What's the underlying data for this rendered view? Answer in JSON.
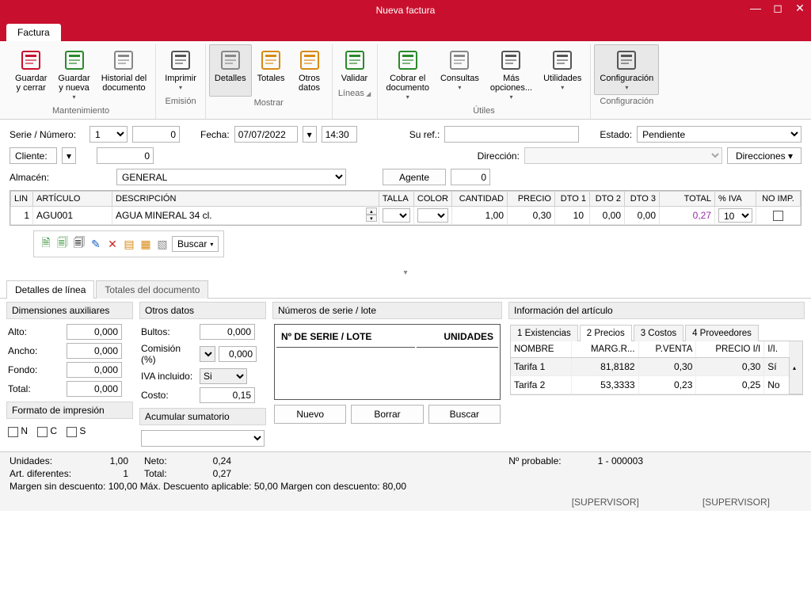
{
  "window": {
    "title": "Nueva factura"
  },
  "tab": {
    "label": "Factura"
  },
  "ribbon": {
    "groups": [
      {
        "label": "Mantenimiento",
        "buttons": [
          {
            "id": "save-close",
            "label": "Guardar\ny cerrar"
          },
          {
            "id": "save-new",
            "label": "Guardar\ny nueva",
            "drop": true
          },
          {
            "id": "doc-history",
            "label": "Historial del\ndocumento"
          }
        ]
      },
      {
        "label": "Emisión",
        "buttons": [
          {
            "id": "print",
            "label": "Imprimir",
            "drop": true
          }
        ]
      },
      {
        "label": "Mostrar",
        "buttons": [
          {
            "id": "details",
            "label": "Detalles",
            "sel": true
          },
          {
            "id": "totals",
            "label": "Totales"
          },
          {
            "id": "other-data",
            "label": "Otros\ndatos"
          }
        ]
      },
      {
        "label": "Líneas",
        "arrow": true,
        "buttons": [
          {
            "id": "validate",
            "label": "Validar"
          }
        ]
      },
      {
        "label": "Útiles",
        "buttons": [
          {
            "id": "charge",
            "label": "Cobrar el\ndocumento",
            "drop": true
          },
          {
            "id": "queries",
            "label": "Consultas",
            "drop": true
          },
          {
            "id": "more",
            "label": "Más\nopciones...",
            "drop": true
          },
          {
            "id": "utils",
            "label": "Utilidades",
            "drop": true
          }
        ]
      },
      {
        "label": "Configuración",
        "buttons": [
          {
            "id": "config",
            "label": "Configuración",
            "drop": true,
            "sel": true
          }
        ]
      }
    ]
  },
  "form": {
    "serie_label": "Serie / Número:",
    "serie": "1",
    "numero": "0",
    "fecha_label": "Fecha:",
    "fecha": "07/07/2022",
    "hora": "14:30",
    "suref_label": "Su ref.:",
    "suref": "",
    "estado_label": "Estado:",
    "estado": "Pendiente",
    "cliente_label": "Cliente:",
    "cliente": "0",
    "direccion_label": "Dirección:",
    "direccion": "",
    "direcciones_btn": "Direcciones",
    "almacen_label": "Almacén:",
    "almacen": "GENERAL",
    "agente_label": "Agente",
    "agente": "0"
  },
  "grid": {
    "headers": {
      "lin": "LIN",
      "art": "ARTÍCULO",
      "desc": "DESCRIPCIÓN",
      "talla": "TALLA",
      "color": "COLOR",
      "cant": "CANTIDAD",
      "precio": "PRECIO",
      "d1": "DTO 1",
      "d2": "DTO 2",
      "d3": "DTO 3",
      "total": "TOTAL",
      "iva": "% IVA",
      "noimp": "NO IMP."
    },
    "rows": [
      {
        "lin": "1",
        "art": "AGU001",
        "desc": "AGUA MINERAL 34 cl.",
        "talla": "",
        "color": "",
        "cant": "1,00",
        "precio": "0,30",
        "d1": "10",
        "d2": "0,00",
        "d3": "0,00",
        "total": "0,27",
        "iva": "10 %",
        "noimp": false
      }
    ]
  },
  "line_toolbar": {
    "search": "Buscar"
  },
  "bottom_tabs": {
    "a": "Detalles de línea",
    "b": "Totales del documento"
  },
  "dims": {
    "title": "Dimensiones auxiliares",
    "alto": "Alto:",
    "alto_v": "0,000",
    "ancho": "Ancho:",
    "ancho_v": "0,000",
    "fondo": "Fondo:",
    "fondo_v": "0,000",
    "total": "Total:",
    "total_v": "0,000",
    "fmt_title": "Formato de impresión",
    "n": "N",
    "c": "C",
    "s": "S"
  },
  "otros": {
    "title": "Otros datos",
    "bultos": "Bultos:",
    "bultos_v": "0,000",
    "comision": "Comisión (%)",
    "comision_v": "0,000",
    "iva": "IVA incluido:",
    "iva_v": "Si",
    "costo": "Costo:",
    "costo_v": "0,15",
    "acum_title": "Acumular sumatorio"
  },
  "serial": {
    "title": "Números de serie / lote",
    "col1": "Nº DE SERIE / LOTE",
    "col2": "UNIDADES",
    "nuevo": "Nuevo",
    "borrar": "Borrar",
    "buscar": "Buscar"
  },
  "info": {
    "title": "Información del artículo",
    "tabs": {
      "t1": "1 Existencias",
      "t2": "2 Precios",
      "t3": "3 Costos",
      "t4": "4 Proveedores"
    },
    "headers": {
      "nombre": "NOMBRE",
      "marg": "MARG.R...",
      "pventa": "P.VENTA",
      "pii": "PRECIO I/I",
      "ii": "I/I."
    },
    "rows": [
      {
        "nombre": "Tarifa 1",
        "marg": "81,8182",
        "pventa": "0,30",
        "pii": "0,30",
        "ii": "Sí"
      },
      {
        "nombre": "Tarifa 2",
        "marg": "53,3333",
        "pventa": "0,23",
        "pii": "0,25",
        "ii": "No"
      }
    ]
  },
  "footer": {
    "unidades_l": "Unidades:",
    "unidades_v": "1,00",
    "neto_l": "Neto:",
    "neto_v": "0,24",
    "artdif_l": "Art. diferentes:",
    "artdif_v": "1",
    "total_l": "Total:",
    "total_v": "0,27",
    "nprob_l": "Nº probable:",
    "nprob_v": "1 - 000003",
    "margin_text": "Margen sin descuento: 100,00  Máx. Descuento aplicable: 50,00  Margen con descuento: 80,00",
    "status": "[SUPERVISOR]"
  }
}
